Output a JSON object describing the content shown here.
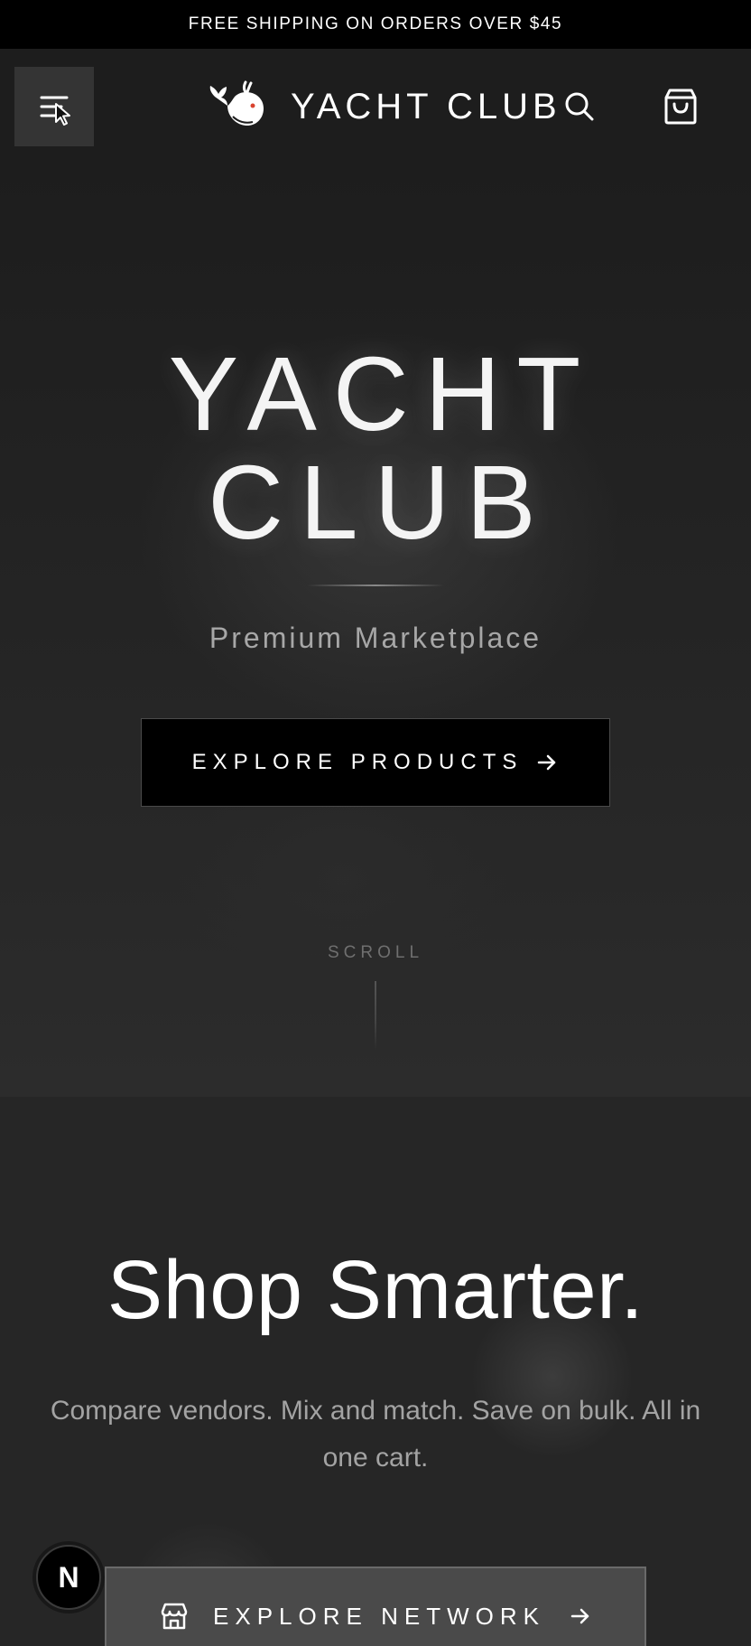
{
  "announcement": {
    "text": "FREE SHIPPING ON ORDERS OVER $45"
  },
  "header": {
    "brand_name": "YACHT CLUB",
    "menu_icon": "menu-icon",
    "logo_icon": "whale-logo-icon",
    "search_icon": "search-icon",
    "cart_icon": "shopping-bag-icon"
  },
  "hero": {
    "title_line1": "YACHT",
    "title_line2": "CLUB",
    "subtitle": "Premium Marketplace",
    "cta_label": "EXPLORE PRODUCTS",
    "scroll_label": "SCROLL"
  },
  "section2": {
    "title": "Shop Smarter.",
    "text": "Compare vendors. Mix and match. Save on bulk. All in one cart.",
    "cta_label": "EXPLORE NETWORK",
    "cta_icon": "store-icon"
  },
  "badge": {
    "letter": "N"
  },
  "colors": {
    "announcement_bg": "#000000",
    "header_bg": "#1d1d1d",
    "page_bg": "#262626",
    "primary_button_bg": "#000000",
    "secondary_button_bg": "#4a4a4a",
    "logo_eye": "#d9432f"
  }
}
